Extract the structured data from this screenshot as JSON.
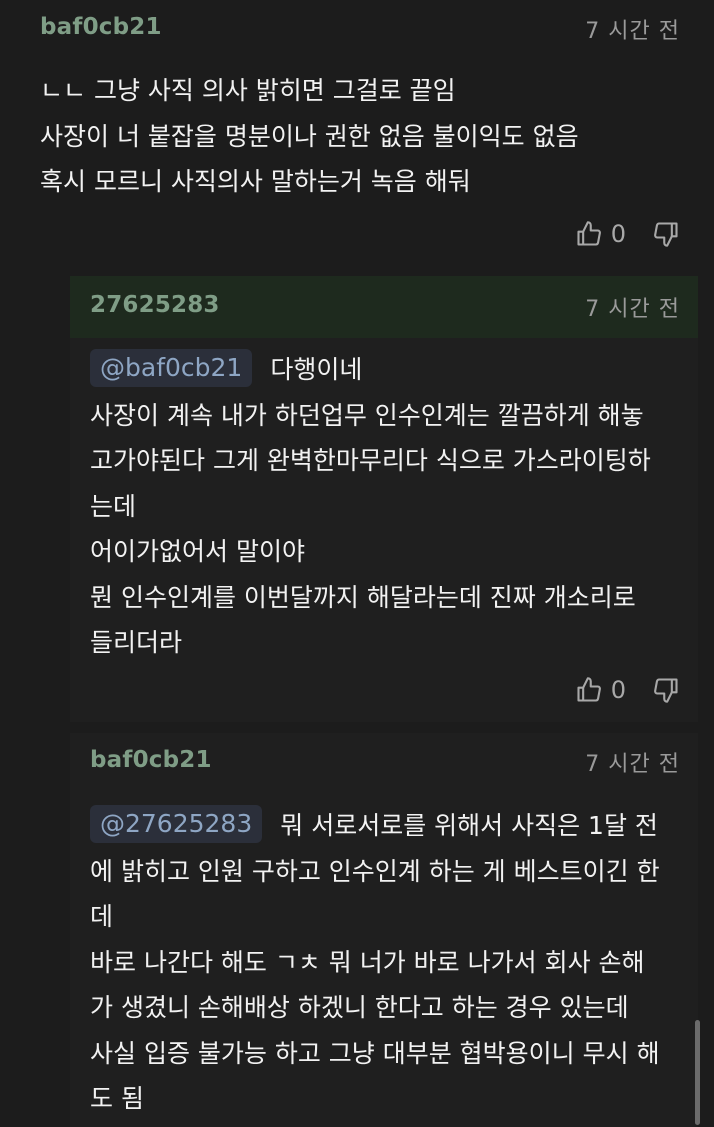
{
  "comments": [
    {
      "author": "baf0cb21",
      "time": "7 시간 전",
      "lines": [
        "ㄴㄴ 그냥 사직 의사 밝히면 그걸로 끝임",
        "사장이 너 붙잡을 명분이나 권한 없음 불이익도 없음",
        "혹시 모르니 사직의사 말하는거 녹음 해둬"
      ],
      "likes": "0"
    },
    {
      "author": "27625283",
      "time": "7 시간 전",
      "mention": "@baf0cb21",
      "first_line": "다행이네",
      "lines": [
        "사장이 계속 내가 하던업무 인수인계는 깔끔하게 해놓",
        "고가야된다 그게 완벽한마무리다 식으로 가스라이팅하",
        "는데",
        "어이가없어서 말이야",
        "뭔 인수인계를 이번달까지 해달라는데 진짜 개소리로",
        "들리더라"
      ],
      "likes": "0"
    },
    {
      "author": "baf0cb21",
      "time": "7 시간 전",
      "mention": "@27625283",
      "first_line": "뭐 서로서로를 위해서 사직은 1달 전",
      "lines": [
        "에 밝히고 인원 구하고 인수인계 하는 게 베스트이긴 한",
        "데",
        "바로 나간다 해도 ㄱㅊ 뭐 너가 바로 나가서 회사 손해",
        "가 생겼니 손해배상 하겠니 한다고 하는 경우 있는데",
        "사실 입증 불가능 하고 그냥 대부분 협박용이니 무시 해",
        "도 됨"
      ]
    }
  ],
  "colors": {
    "background": "#1c1c1c",
    "author": "#7f9d86",
    "mention_bg": "#2b2f3a",
    "mention_text": "#8ea6c4",
    "highlight": "#1e2a1e"
  },
  "icons": {
    "like": "thumbs-up-icon",
    "dislike": "thumbs-down-icon"
  }
}
